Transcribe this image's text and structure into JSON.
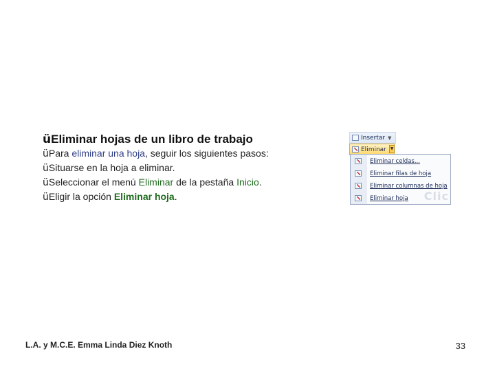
{
  "heading": {
    "check": "ü",
    "text": "Eliminar hojas de un libro de trabajo"
  },
  "bullets": [
    {
      "check": "ü",
      "pre": "Para ",
      "kw": "eliminar una hoja",
      "post": ", seguir los siguientes pasos:"
    },
    {
      "check": "ü",
      "text": "Situarse en la hoja a eliminar."
    },
    {
      "check": "ü",
      "pre": "Seleccionar el menú ",
      "kw1": "Eliminar",
      "mid": " de la pestaña ",
      "kw2": "Inicio",
      "post": "."
    },
    {
      "check": "ü",
      "pre": "Eligir la opción ",
      "kw": "Eliminar hoja",
      "post": "."
    }
  ],
  "excel_menu": {
    "insert_label": "Insertar",
    "delete_label": "Eliminar",
    "items": [
      "Eliminar celdas...",
      "Eliminar filas de hoja",
      "Eliminar columnas de hoja",
      "Eliminar hoja"
    ],
    "watermark": "Clic"
  },
  "footer": {
    "author": "L.A. y M.C.E. Emma Linda Diez Knoth",
    "page": "33"
  }
}
